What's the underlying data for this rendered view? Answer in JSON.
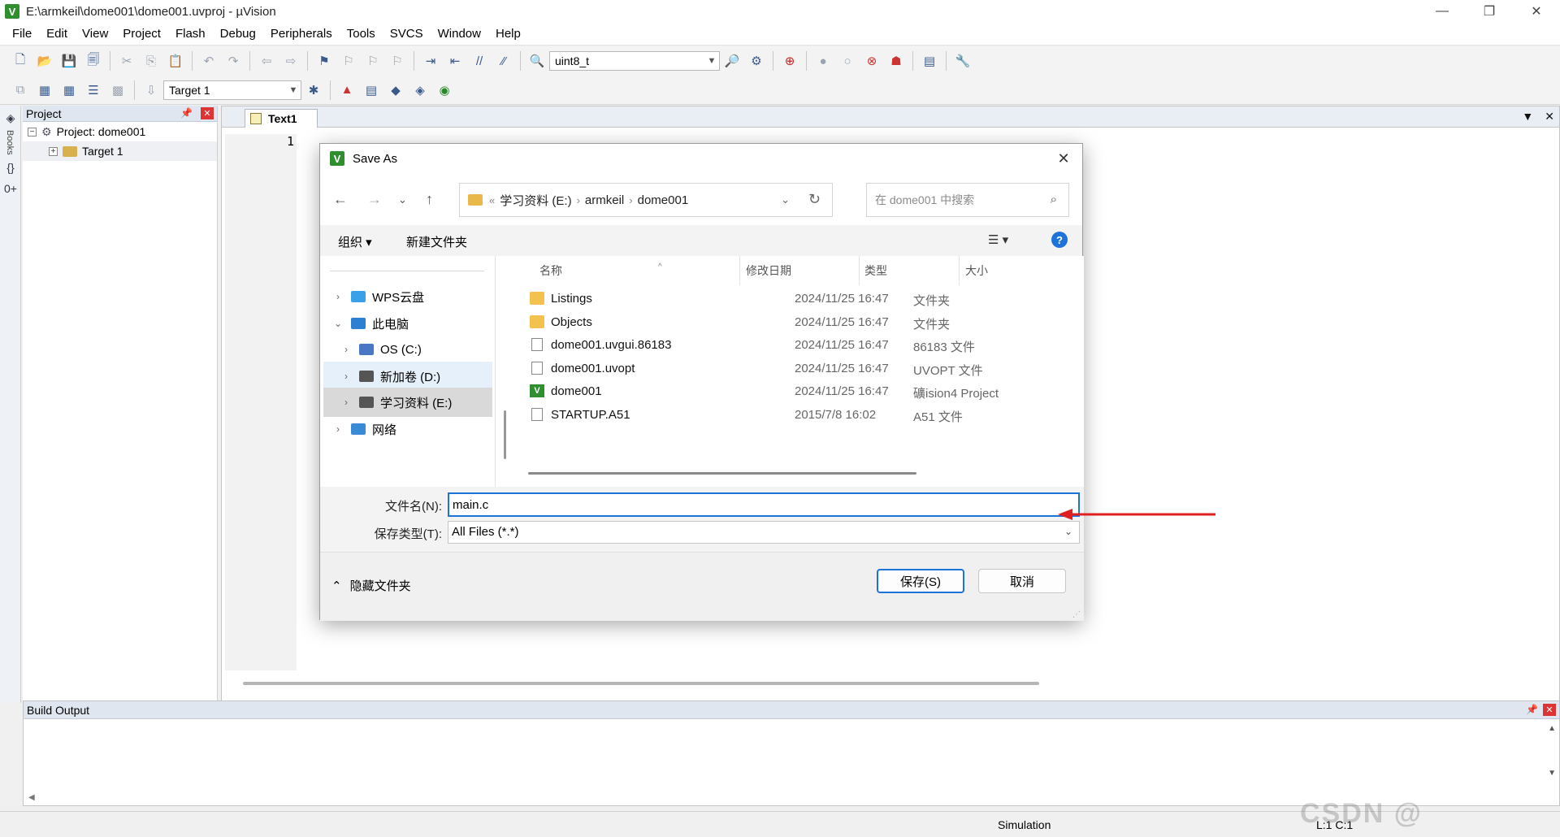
{
  "window": {
    "title": "E:\\armkeil\\dome001\\dome001.uvproj - µVision",
    "controls": [
      "—",
      "❐",
      "✕"
    ]
  },
  "menu": [
    "File",
    "Edit",
    "View",
    "Project",
    "Flash",
    "Debug",
    "Peripherals",
    "Tools",
    "SVCS",
    "Window",
    "Help"
  ],
  "toolbar": {
    "find_combo": "uint8_t",
    "target_combo": "Target 1"
  },
  "project_panel": {
    "title": "Project",
    "root": "Project: dome001",
    "target": "Target 1"
  },
  "left_strip": {
    "books_label": "Books",
    "functions_label": "{}",
    "templates_label": "0+"
  },
  "editor": {
    "tab_label": "Text1",
    "line_number": "1"
  },
  "build_output": {
    "title": "Build Output"
  },
  "statusbar": {
    "mode": "Simulation",
    "position": "L:1 C:1"
  },
  "dialog": {
    "title": "Save As",
    "breadcrumb": [
      "学习资料 (E:)",
      "armkeil",
      "dome001"
    ],
    "breadcrumb_prefix": "«",
    "search_placeholder": "在 dome001 中搜索",
    "organize": "组织 ▾",
    "new_folder": "新建文件夹",
    "help": "?",
    "nav_items": [
      {
        "label": "WPS云盘",
        "chevron": "›",
        "icon": "cloud-icon",
        "color": "#3aa0e8",
        "state": ""
      },
      {
        "label": "此电脑",
        "chevron": "⌄",
        "icon": "computer-icon",
        "color": "#2c7fd1",
        "state": ""
      },
      {
        "label": "OS (C:)",
        "chevron": "›",
        "icon": "windows-drive-icon",
        "color": "#4a77c4",
        "state": ""
      },
      {
        "label": "新加卷 (D:)",
        "chevron": "›",
        "icon": "drive-icon",
        "color": "#555555",
        "state": "hover"
      },
      {
        "label": "学习资料 (E:)",
        "chevron": "›",
        "icon": "drive-icon",
        "color": "#555555",
        "state": "selected"
      },
      {
        "label": "网络",
        "chevron": "›",
        "icon": "network-icon",
        "color": "#3a8ad6",
        "state": ""
      }
    ],
    "columns": {
      "name": "名称",
      "date": "修改日期",
      "type": "类型",
      "size": "大小"
    },
    "files": [
      {
        "name": "Listings",
        "date": "2024/11/25 16:47",
        "type": "文件夹",
        "icon": "folder-icon"
      },
      {
        "name": "Objects",
        "date": "2024/11/25 16:47",
        "type": "文件夹",
        "icon": "folder-icon"
      },
      {
        "name": "dome001.uvgui.86183",
        "date": "2024/11/25 16:47",
        "type": "86183 文件",
        "icon": "file-icon"
      },
      {
        "name": "dome001.uvopt",
        "date": "2024/11/25 16:47",
        "type": "UVOPT 文件",
        "icon": "file-icon"
      },
      {
        "name": "dome001",
        "date": "2024/11/25 16:47",
        "type": "礦ision4 Project",
        "icon": "uvision-project-icon"
      },
      {
        "name": "STARTUP.A51",
        "date": "2015/7/8 16:02",
        "type": "A51 文件",
        "icon": "file-icon"
      }
    ],
    "filename_label": "文件名(N):",
    "filename_value": "main.c",
    "filetype_label": "保存类型(T):",
    "filetype_value": "All Files (*.*)",
    "hide_folders": "隐藏文件夹",
    "save_button": "保存(S)",
    "cancel_button": "取消"
  },
  "annotation": {
    "arrow_color": "#e02020"
  },
  "watermark": "CSDN @"
}
